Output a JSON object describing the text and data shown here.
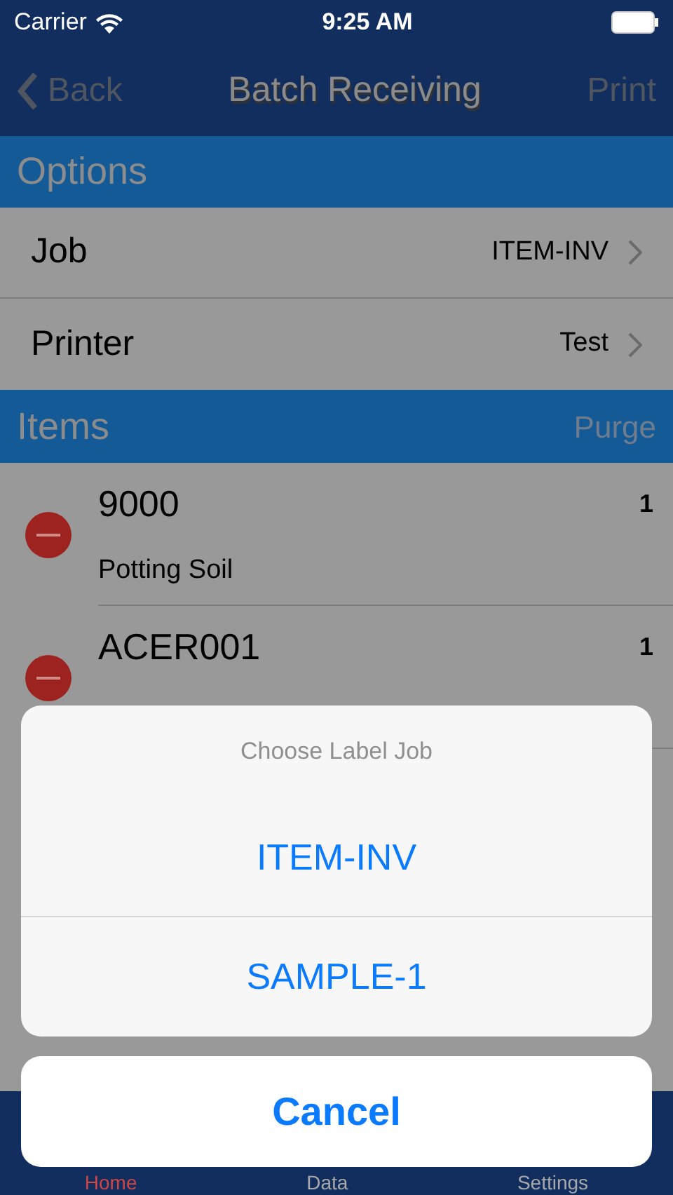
{
  "status_bar": {
    "carrier": "Carrier",
    "time": "9:25 AM"
  },
  "nav_bar": {
    "back": "Back",
    "title": "Batch Receiving",
    "action": "Print"
  },
  "options": {
    "header": "Options",
    "rows": [
      {
        "label": "Job",
        "value": "ITEM-INV"
      },
      {
        "label": "Printer",
        "value": "Test"
      }
    ]
  },
  "items": {
    "header": "Items",
    "action": "Purge",
    "rows": [
      {
        "code": "9000",
        "description": "Potting Soil",
        "quantity": "1"
      },
      {
        "code": "ACER001",
        "quantity": "1"
      }
    ]
  },
  "tab_bar": [
    {
      "label": "Home",
      "selected": true
    },
    {
      "label": "Data",
      "selected": false
    },
    {
      "label": "Settings",
      "selected": false
    }
  ],
  "action_sheet": {
    "title": "Choose Label Job",
    "options": [
      "ITEM-INV",
      "SAMPLE-1"
    ],
    "cancel": "Cancel"
  }
}
